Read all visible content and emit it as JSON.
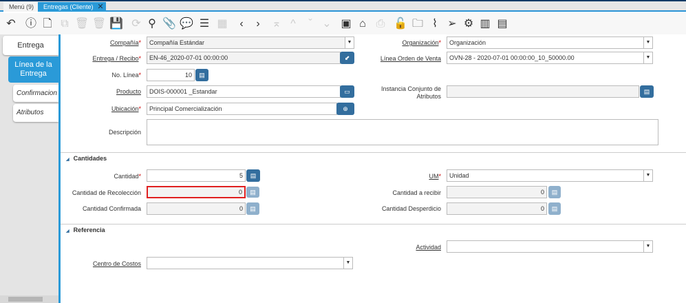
{
  "tabs": [
    {
      "label": "Menú (9)"
    },
    {
      "label": "Entregas (Cliente)"
    }
  ],
  "toolbar": [
    "undo-icon",
    "help-icon",
    "new-icon",
    "copy-icon",
    "delete-icon",
    "delete-selection-icon",
    "save-icon",
    "refresh-icon",
    "search-icon",
    "attachment-icon",
    "chat-icon",
    "grid-toggle-icon",
    "calendar-icon",
    "previous-icon",
    "next-icon",
    "first-icon",
    "parent-icon",
    "detail-icon",
    "last-icon",
    "report-icon",
    "archive-icon",
    "print-icon",
    "lock-icon",
    "zoom-across-icon",
    "workflow-icon",
    "send-icon",
    "process-icon",
    "barcode-icon",
    "ticket-icon"
  ],
  "left_tabs": {
    "t1": "Entrega",
    "t2": "Línea de la Entrega",
    "t3": "Confirmacion",
    "t4": "Atributos"
  },
  "fields": {
    "company": {
      "label": "Compañía",
      "value": "Compañía Estándar"
    },
    "org": {
      "label": "Organización",
      "value": "Organización"
    },
    "shipment": {
      "label": "Entrega / Recibo",
      "value": "EN-46_2020-07-01 00:00:00"
    },
    "order_line": {
      "label": "Línea Orden de Venta",
      "value": "OVN-28 - 2020-07-01 00:00:00_10_50000.00"
    },
    "line_no": {
      "label": "No. Línea",
      "value": "10"
    },
    "product": {
      "label": "Producto",
      "value": "DOIS-000001 _Estandar"
    },
    "attr_set": {
      "label": "Instancia Conjunto de Atributos",
      "value": ""
    },
    "locator": {
      "label": "Ubicación",
      "value": "Principal Comercialización"
    },
    "description": {
      "label": "Descripción",
      "value": ""
    }
  },
  "quantities": {
    "title": "Cantidades",
    "qty": {
      "label": "Cantidad",
      "value": "5"
    },
    "uom": {
      "label": "UM",
      "value": "Unidad"
    },
    "picked": {
      "label": "Cantidad de Recolección",
      "value": "0"
    },
    "target": {
      "label": "Cantidad a recibir",
      "value": "0"
    },
    "confirmed": {
      "label": "Cantidad Confirmada",
      "value": "0"
    },
    "scrapped": {
      "label": "Cantidad Desperdicio",
      "value": "0"
    }
  },
  "reference": {
    "title": "Referencia",
    "activity": {
      "label": "Actividad",
      "value": ""
    },
    "cost_center": {
      "label": "Centro de Costos",
      "value": ""
    }
  },
  "colors": {
    "accent": "#2a9ad8",
    "button": "#336e9e",
    "error_border": "#e02020"
  }
}
